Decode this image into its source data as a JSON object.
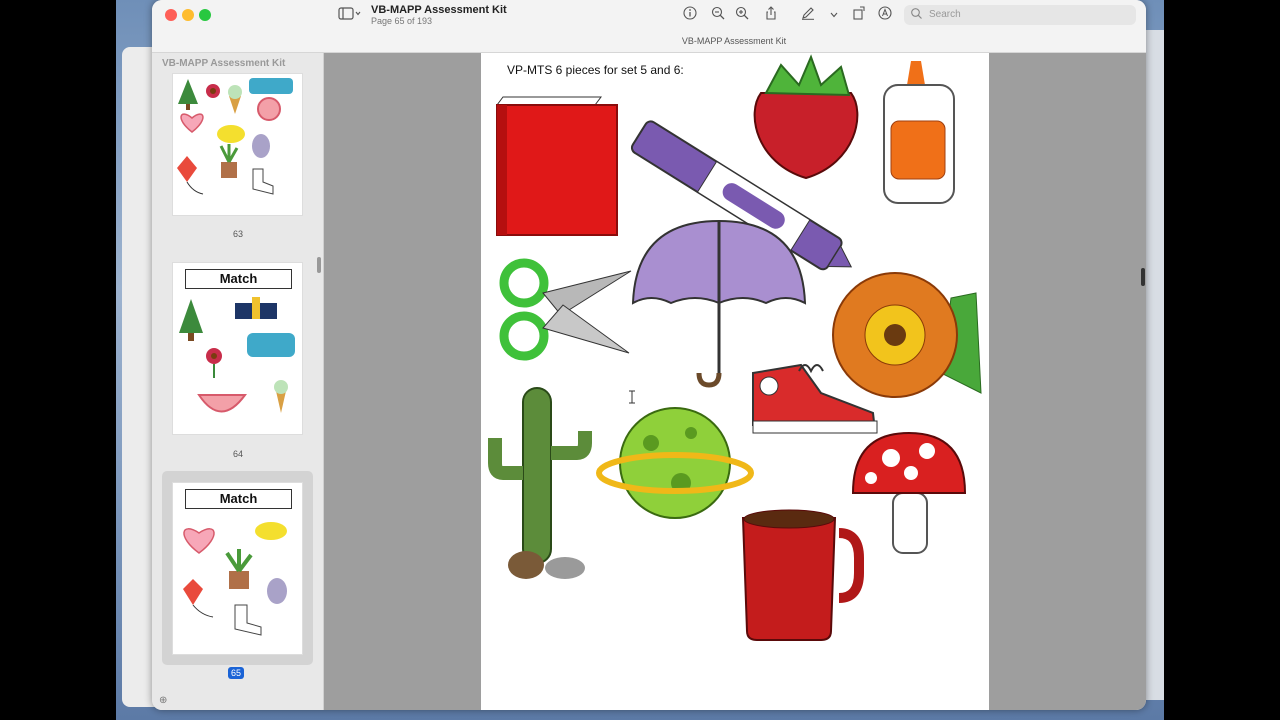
{
  "window": {
    "title": "VB-MAPP Assessment Kit",
    "subtitle": "Page 65 of 193",
    "doc_tab": "VB-MAPP Assessment Kit"
  },
  "search": {
    "placeholder": "Search"
  },
  "sidebar": {
    "title": "VB-MAPP Assessment Kit",
    "pages": [
      {
        "number": "63"
      },
      {
        "number": "64",
        "heading": "Match"
      },
      {
        "number": "65",
        "heading": "Match",
        "selected": true
      }
    ]
  },
  "page": {
    "caption": "VP-MTS 6 pieces for set 5 and 6:"
  },
  "icons": [
    "sidebar-toggle-icon",
    "info-icon",
    "zoom-out-icon",
    "zoom-in-icon",
    "share-icon",
    "markup-pen-icon",
    "rotate-icon",
    "annotate-icon",
    "search-icon",
    "text-cursor-icon"
  ],
  "colors": {
    "accent": "#1a63d6",
    "red_button": "#fe5f57",
    "yellow_button": "#febc2e",
    "green_button": "#28c840"
  }
}
